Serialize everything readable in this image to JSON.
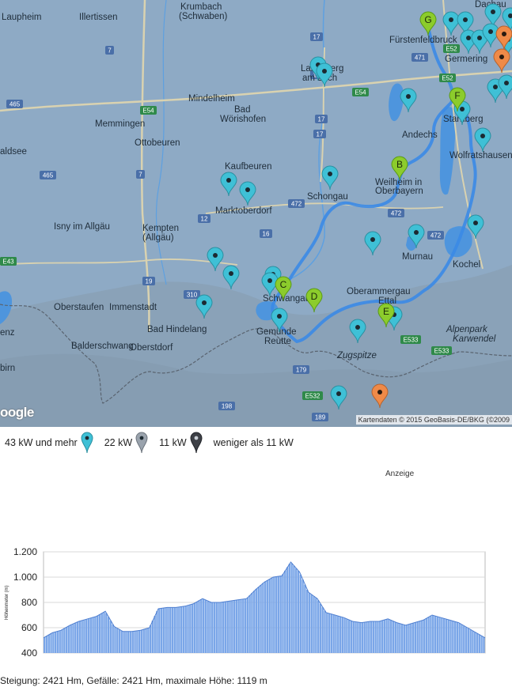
{
  "map": {
    "attribution": "Kartendaten © 2015 GeoBasis-DE/BKG (©2009",
    "logo": "oogle",
    "water_color": "#4e95dd",
    "land_color": "#90acc6",
    "route_color": "#3b8ae6",
    "places": [
      {
        "text": "Laupheim"
      },
      {
        "text": "Illertissen"
      },
      {
        "text": "Krumbach"
      },
      {
        "text": "(Schwaben)"
      },
      {
        "text": "Dachau"
      },
      {
        "text": "Fürstenfeldbruck"
      },
      {
        "text": "Germering"
      },
      {
        "text": "Landsberg"
      },
      {
        "text": "am Lech"
      },
      {
        "text": "Mindelheim"
      },
      {
        "text": "Bad"
      },
      {
        "text": "Wörishofen"
      },
      {
        "text": "Memmingen"
      },
      {
        "text": "Ottobeuren"
      },
      {
        "text": "aldsee"
      },
      {
        "text": "Andechs"
      },
      {
        "text": "Starnberg"
      },
      {
        "text": "Wolfratshausen"
      },
      {
        "text": "Kaufbeuren"
      },
      {
        "text": "Marktoberdorf"
      },
      {
        "text": "Schongau"
      },
      {
        "text": "Weilheim in"
      },
      {
        "text": "Oberbayern"
      },
      {
        "text": "Kempten"
      },
      {
        "text": "(Allgäu)"
      },
      {
        "text": "Isny im Allgäu"
      },
      {
        "text": "Murnau"
      },
      {
        "text": "Kochel"
      },
      {
        "text": "Oberstaufen"
      },
      {
        "text": "Immenstadt"
      },
      {
        "text": "Schwangau"
      },
      {
        "text": "Oberammergau"
      },
      {
        "text": "Ettal"
      },
      {
        "text": "Bad Hindelang"
      },
      {
        "text": "Gemünde"
      },
      {
        "text": "Reutte"
      },
      {
        "text": "Balderschwang"
      },
      {
        "text": "Oberstdorf"
      },
      {
        "text": "Zugspitze"
      },
      {
        "text": "Alpenpark"
      },
      {
        "text": "Karwendel"
      },
      {
        "text": "enz"
      },
      {
        "text": "birn"
      }
    ],
    "road_labels": [
      "7",
      "17",
      "465",
      "E54",
      "E54",
      "17",
      "465",
      "7",
      "E43",
      "472",
      "12",
      "472",
      "472",
      "16",
      "19",
      "E43",
      "310",
      "179",
      "E533",
      "E533",
      "E532",
      "198",
      "189",
      "471",
      "E52",
      "17",
      "17",
      "E52"
    ],
    "waypoints": [
      "G",
      "F",
      "B",
      "C",
      "D",
      "E"
    ]
  },
  "legend": {
    "items": [
      {
        "label": "43 kW und mehr",
        "color": "#3fc0d6"
      },
      {
        "label": "22 kW",
        "color": "#9aa3ad"
      },
      {
        "label": "11 kW",
        "color": "#3d4046"
      },
      {
        "label": "weniger als 11 kW",
        "color": null
      }
    ]
  },
  "ad_label": "Anzeige",
  "chart_data": {
    "type": "area",
    "ylabel": "Höhenmeter (m)",
    "ylim": [
      400,
      1200
    ],
    "yticks": [
      "1.200",
      "1.000",
      "800",
      "600",
      "400"
    ],
    "ytick_values": [
      1200,
      1000,
      800,
      600,
      400
    ],
    "grid": true,
    "color": "#7aa6e8",
    "x": [
      0,
      2,
      4,
      6,
      8,
      10,
      12,
      14,
      16,
      18,
      20,
      22,
      24,
      26,
      28,
      30,
      32,
      34,
      36,
      38,
      40,
      42,
      44,
      46,
      48,
      50,
      52,
      54,
      56,
      58,
      60,
      62,
      64,
      66,
      68,
      70,
      72,
      74,
      76,
      78,
      80,
      82,
      84,
      86,
      88,
      90,
      92,
      94,
      96,
      98,
      100
    ],
    "values": [
      520,
      560,
      580,
      620,
      650,
      670,
      690,
      730,
      610,
      570,
      570,
      580,
      600,
      750,
      760,
      760,
      770,
      790,
      830,
      800,
      800,
      810,
      820,
      830,
      900,
      960,
      1000,
      1010,
      1119,
      1040,
      880,
      830,
      720,
      700,
      680,
      650,
      640,
      650,
      650,
      670,
      640,
      620,
      640,
      660,
      700,
      680,
      660,
      640,
      600,
      560,
      520
    ]
  },
  "summary": "Steigung: 2421 Hm, Gefälle: 2421 Hm, maximale Höhe: 1119 m"
}
